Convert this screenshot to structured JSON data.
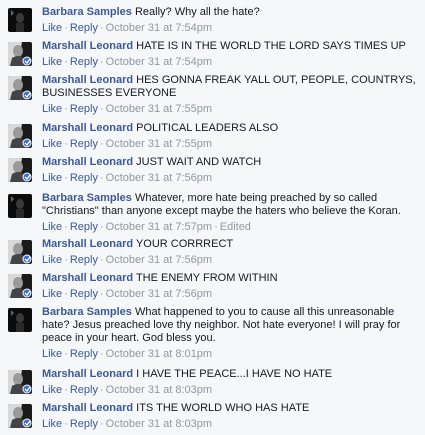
{
  "comments": [
    {
      "author": "Barbara Samples",
      "avatar": "barbara",
      "text": "Really? Why all the hate?",
      "like": "Like",
      "reply": "Reply",
      "time": "October 31 at 7:54pm",
      "edited": ""
    },
    {
      "author": "Marshall Leonard",
      "avatar": "marshall",
      "text": "HATE IS IN THE WORLD THE LORD SAYS TIMES UP",
      "like": "Like",
      "reply": "Reply",
      "time": "October 31 at 7:54pm",
      "edited": ""
    },
    {
      "author": "Marshall Leonard",
      "avatar": "marshall",
      "text": "HES GONNA FREAK YALL OUT, PEOPLE, COUNTRYS, BUSINESSES EVERYONE",
      "like": "Like",
      "reply": "Reply",
      "time": "October 31 at 7:55pm",
      "edited": ""
    },
    {
      "author": "Marshall Leonard",
      "avatar": "marshall",
      "text": "POLITICAL LEADERS ALSO",
      "like": "Like",
      "reply": "Reply",
      "time": "October 31 at 7:55pm",
      "edited": ""
    },
    {
      "author": "Marshall Leonard",
      "avatar": "marshall",
      "text": "JUST WAIT AND WATCH",
      "like": "Like",
      "reply": "Reply",
      "time": "October 31 at 7:56pm",
      "edited": ""
    },
    {
      "author": "Barbara Samples",
      "avatar": "barbara",
      "text": "Whatever, more hate being preached by so called \"Christians\" than anyone except maybe the haters who believe the Koran.",
      "like": "Like",
      "reply": "Reply",
      "time": "October 31 at 7:57pm",
      "edited": "Edited"
    },
    {
      "author": "Marshall Leonard",
      "avatar": "marshall",
      "text": "YOUR CORRRECT",
      "like": "Like",
      "reply": "Reply",
      "time": "October 31 at 7:56pm",
      "edited": ""
    },
    {
      "author": "Marshall Leonard",
      "avatar": "marshall",
      "text": "THE ENEMY FROM WITHIN",
      "like": "Like",
      "reply": "Reply",
      "time": "October 31 at 7:56pm",
      "edited": ""
    },
    {
      "author": "Barbara Samples",
      "avatar": "barbara",
      "text": "What happened to you to cause all this unreasonable hate? Jesus preached love thy neighbor. Not hate everyone! I will pray for peace in your heart. God bless you.",
      "like": "Like",
      "reply": "Reply",
      "time": "October 31 at 8:01pm",
      "edited": ""
    },
    {
      "author": "Marshall Leonard",
      "avatar": "marshall",
      "text": "I HAVE THE PEACE...I HAVE NO HATE",
      "like": "Like",
      "reply": "Reply",
      "time": "October 31 at 8:03pm",
      "edited": ""
    },
    {
      "author": "Marshall Leonard",
      "avatar": "marshall",
      "text": "ITS THE WORLD WHO HAS HATE",
      "like": "Like",
      "reply": "Reply",
      "time": "October 31 at 8:03pm",
      "edited": ""
    }
  ],
  "colors": {
    "link": "#3b5998",
    "meta": "#9197a3",
    "text": "#141823",
    "background": "#f6f7f9"
  }
}
